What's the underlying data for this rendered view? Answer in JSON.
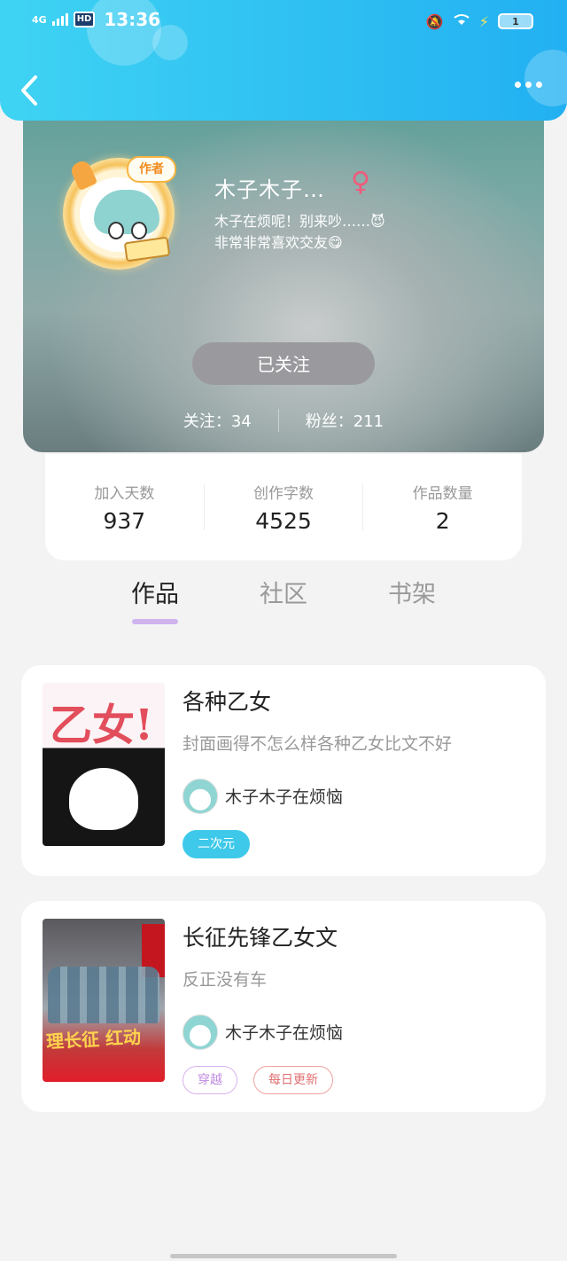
{
  "status_bar": {
    "network": "4G",
    "hd": "HD",
    "time": "13:36",
    "battery": "1"
  },
  "header": {
    "back_icon": "chevron-left-icon",
    "more_icon": "more-dots-icon"
  },
  "profile": {
    "avatar_badge": "作者",
    "name": "木子木子…",
    "gender_icon": "female-icon",
    "bio": "  木子在烦呢！别来吵……😈\n非常非常喜欢交友😋",
    "follow_label": "已关注",
    "following": "关注：34",
    "followers": "粉丝：211"
  },
  "stats": [
    {
      "label": "加入天数",
      "value": "937"
    },
    {
      "label": "创作字数",
      "value": "4525"
    },
    {
      "label": "作品数量",
      "value": "2"
    }
  ],
  "tabs": [
    {
      "label": "作品",
      "active": true
    },
    {
      "label": "社区",
      "active": false
    },
    {
      "label": "书架",
      "active": false
    }
  ],
  "books": [
    {
      "cover_text": "乙女!",
      "title": "各种乙女",
      "desc": "封面画得不怎么样各种乙女比文不好",
      "author": "木子木子在烦恼",
      "tags": [
        {
          "label": "二次元",
          "style": "cyan"
        }
      ]
    },
    {
      "cover_text": "理长征 红动",
      "title": "长征先锋乙女文",
      "desc": "反正没有车",
      "author": "木子木子在烦恼",
      "tags": [
        {
          "label": "穿越",
          "style": "purple"
        },
        {
          "label": "每日更新",
          "style": "red"
        }
      ]
    }
  ],
  "colors": {
    "header_start": "#3fd3f3",
    "header_end": "#22b0f2",
    "tab_active_underline": "#cfb4ee"
  }
}
